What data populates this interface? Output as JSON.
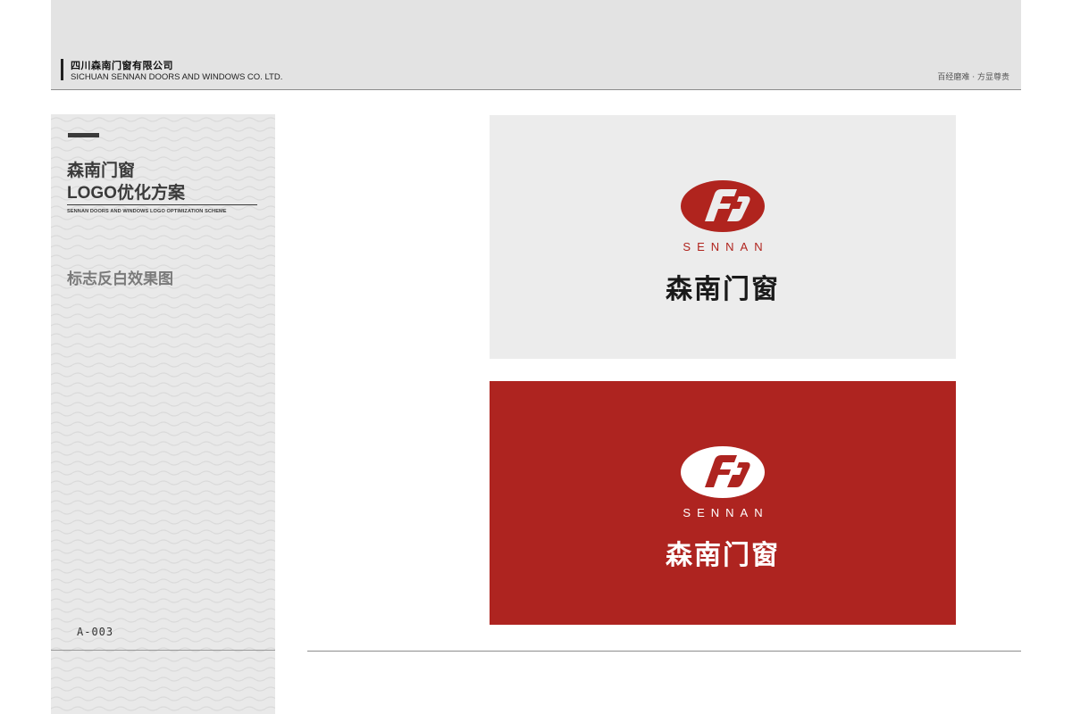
{
  "header": {
    "company_cn": "四川森南门窗有限公司",
    "company_en": "SICHUAN SENNAN DOORS AND WINDOWS CO. LTD.",
    "slogan": "百经磨难 · 方显尊贵"
  },
  "sidebar": {
    "title_line1": "森南门窗",
    "title_line2": "LOGO优化方案",
    "subtitle": "SENNAN DOORS AND WINDOWS LOGO OPTIMIZATION SCHEME",
    "section": "标志反白效果图",
    "code": "A-003"
  },
  "logos": {
    "brand_en": "SENNAN",
    "brand_cn": "森南门窗",
    "light_panel": {
      "background": "#ececec",
      "emblem_color": "#b0241e",
      "text_color": "#1a1a1a"
    },
    "red_panel": {
      "background": "#ae2420",
      "emblem_color": "#ffffff",
      "text_color": "#ffffff"
    }
  }
}
